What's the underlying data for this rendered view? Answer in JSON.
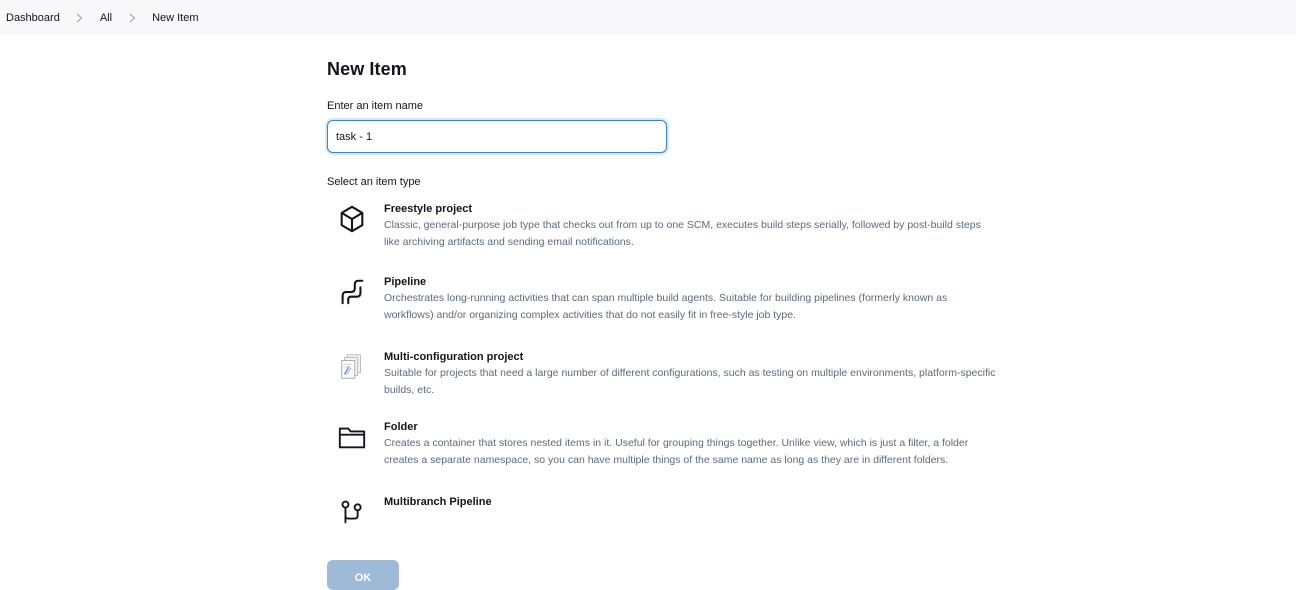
{
  "breadcrumb": {
    "items": [
      "Dashboard",
      "All",
      "New Item"
    ]
  },
  "page": {
    "title": "New Item",
    "name_label": "Enter an item name",
    "name_value": "task - 1",
    "type_label": "Select an item type"
  },
  "item_types": [
    {
      "icon": "cube-icon",
      "title": "Freestyle project",
      "description": "Classic, general-purpose job type that checks out from up to one SCM, executes build steps serially, followed by post-build steps like archiving artifacts and sending email notifications."
    },
    {
      "icon": "pipeline-icon",
      "title": "Pipeline",
      "description": "Orchestrates long-running activities that can span multiple build agents. Suitable for building pipelines (formerly known as workflows) and/or organizing complex activities that do not easily fit in free-style job type."
    },
    {
      "icon": "multi-config-icon",
      "title": "Multi-configuration project",
      "description": "Suitable for projects that need a large number of different configurations, such as testing on multiple environments, platform-specific builds, etc."
    },
    {
      "icon": "folder-icon",
      "title": "Folder",
      "description": "Creates a container that stores nested items in it. Useful for grouping things together. Unlike view, which is just a filter, a folder creates a separate namespace, so you can have multiple things of the same name as long as they are in different folders."
    },
    {
      "icon": "branch-icon",
      "title": "Multibranch Pipeline",
      "description": ""
    }
  ],
  "footer": {
    "ok_label": "OK"
  },
  "colors": {
    "accent": "#3c84c4",
    "ok_button": "#9fbad6",
    "breadcrumb_bg": "#f8f8fa",
    "description_text": "#5a6b7d"
  }
}
